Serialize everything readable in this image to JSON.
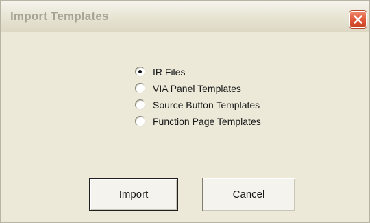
{
  "window": {
    "title": "Import Templates"
  },
  "options": [
    {
      "label": "IR Files",
      "selected": true
    },
    {
      "label": "VIA Panel Templates",
      "selected": false
    },
    {
      "label": "Source Button Templates",
      "selected": false
    },
    {
      "label": "Function Page Templates",
      "selected": false
    }
  ],
  "buttons": {
    "import_label": "Import",
    "cancel_label": "Cancel"
  },
  "colors": {
    "dialog_background": "#ece9d8",
    "close_button": "#e0593a"
  },
  "icons": {
    "close": "close-icon"
  }
}
